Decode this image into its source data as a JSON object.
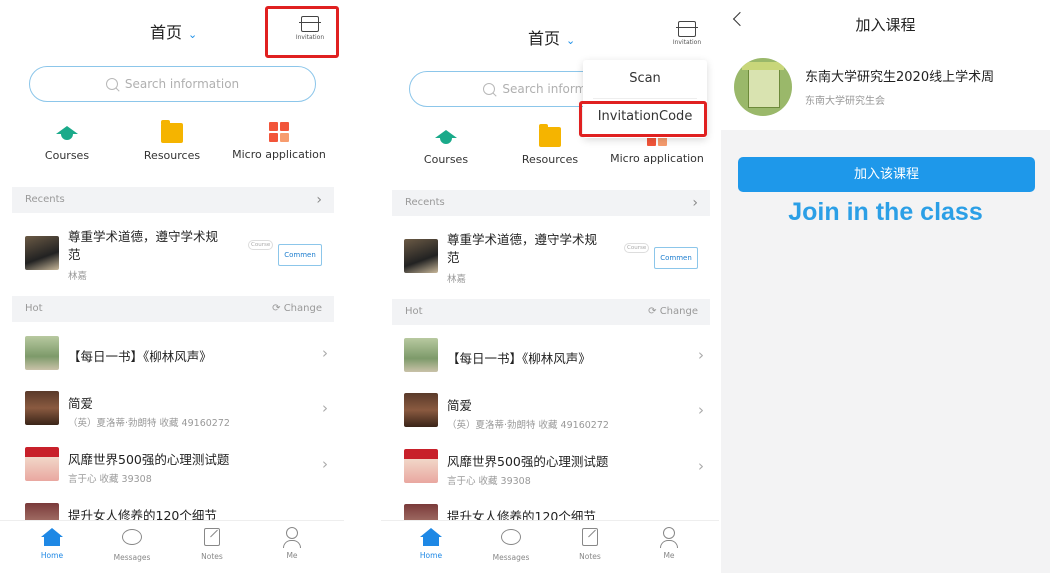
{
  "header": {
    "title": "首页"
  },
  "invitation": {
    "label": "Invitation"
  },
  "search": {
    "placeholder": "Search information"
  },
  "quick": [
    {
      "label": "Courses",
      "icon": "graduation-cap-icon"
    },
    {
      "label": "Resources",
      "icon": "folder-icon"
    },
    {
      "label": "Micro application",
      "icon": "grid-icon"
    }
  ],
  "recents": {
    "title": "Recents",
    "item": {
      "title": "尊重学术道德，遵守学术规范",
      "author": "林嘉",
      "tag": "Course",
      "button": "Commen"
    }
  },
  "hot": {
    "title": "Hot",
    "change": "Change",
    "items": [
      {
        "title": "【每日一书】《柳林风声》",
        "meta": ""
      },
      {
        "title": "简爱",
        "meta": "（英）夏洛蒂·勃朗特 收藏 49160272"
      },
      {
        "title": "风靡世界500强的心理测试题",
        "meta": "言于心 收藏 39308"
      },
      {
        "title": "提升女人修养的120个细节",
        "meta": ""
      }
    ]
  },
  "tabs": [
    {
      "label": "Home"
    },
    {
      "label": "Messages"
    },
    {
      "label": "Notes"
    },
    {
      "label": "Me"
    }
  ],
  "dropdown": {
    "scan": "Scan",
    "invitation_code": "InvitationCode"
  },
  "join": {
    "title": "加入课程",
    "course_name": "东南大学研究生2020线上学术周",
    "course_org": "东南大学研究生会",
    "button": "加入该课程",
    "annotation": "Join in the class"
  },
  "colors": {
    "accent": "#1e88e5",
    "highlight": "#e02020",
    "button": "#1e98ea"
  }
}
